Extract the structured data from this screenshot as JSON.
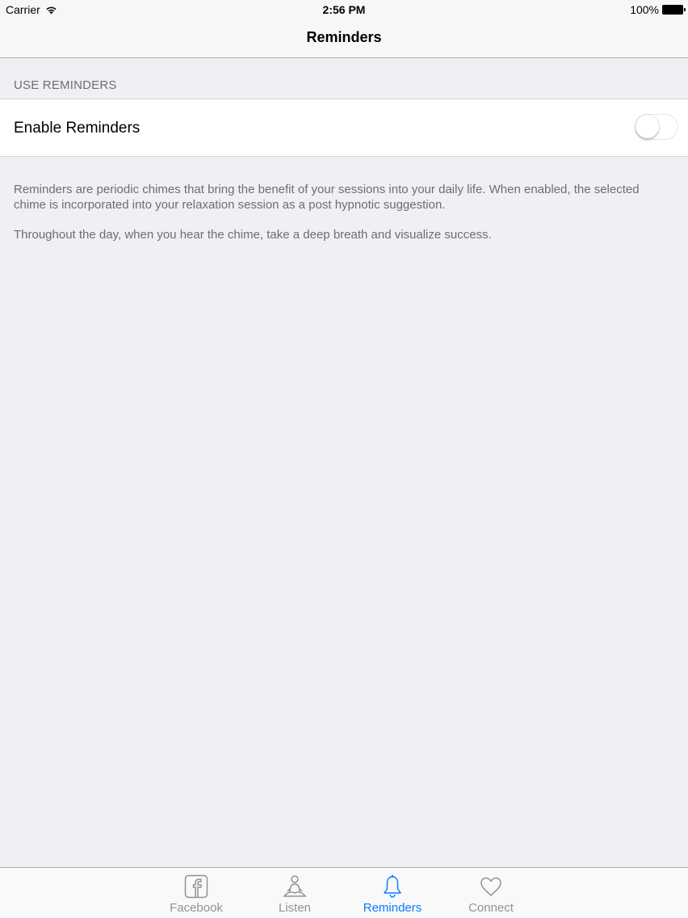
{
  "status_bar": {
    "carrier": "Carrier",
    "time": "2:56 PM",
    "battery": "100%"
  },
  "nav": {
    "title": "Reminders"
  },
  "section": {
    "header": "USE REMINDERS",
    "cell_label": "Enable Reminders",
    "toggle_on": false
  },
  "footer": {
    "paragraph1": "Reminders are periodic chimes that bring the benefit of your sessions into your daily life.  When enabled, the selected chime is incorporated into your relaxation session as a post hypnotic suggestion.",
    "paragraph2": "Throughout the day, when you hear the chime, take a deep breath and visualize success."
  },
  "tabs": [
    {
      "label": "Facebook",
      "icon": "facebook-icon",
      "active": false
    },
    {
      "label": "Listen",
      "icon": "meditation-icon",
      "active": false
    },
    {
      "label": "Reminders",
      "icon": "bell-icon",
      "active": true
    },
    {
      "label": "Connect",
      "icon": "heart-icon",
      "active": false
    }
  ],
  "colors": {
    "accent": "#0a7aff",
    "inactive": "#929292",
    "background": "#efeff4"
  }
}
